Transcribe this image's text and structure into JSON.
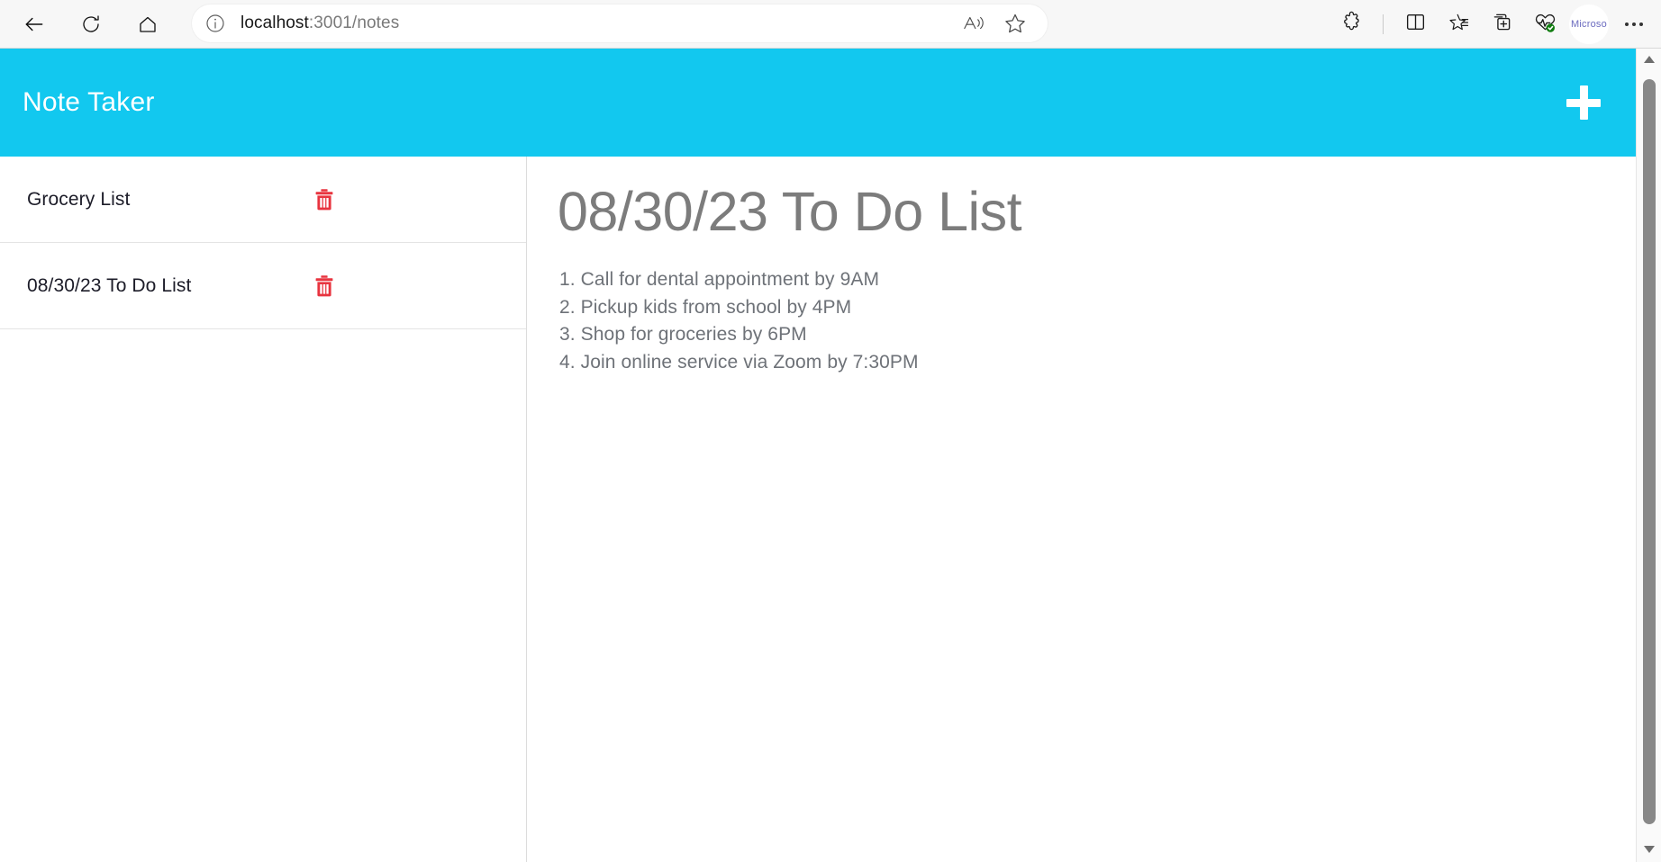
{
  "browser": {
    "nav": [
      {
        "name": "back-button",
        "icon": "back-arrow-icon",
        "label": "Back"
      },
      {
        "name": "refresh-button",
        "icon": "refresh-icon",
        "label": "Refresh"
      },
      {
        "name": "home-button",
        "icon": "home-icon",
        "label": "Home"
      }
    ],
    "address_bar": {
      "info_icon": "site-info-icon",
      "url_host": "localhost",
      "url_rest": ":3001/notes",
      "full_url": "localhost:3001/notes",
      "placeholder": "Search or enter web address",
      "read_aloud_icon": "read-aloud-icon",
      "favorite_icon": "favorite-star-icon"
    },
    "toolbar_right": [
      {
        "name": "extensions-button",
        "icon": "extensions-puzzle-icon",
        "label": "Extensions"
      },
      {
        "name": "split-screen-button",
        "icon": "split-screen-icon",
        "label": "Split screen"
      },
      {
        "name": "favorites-button",
        "icon": "favorites-list-icon",
        "label": "Favorites"
      },
      {
        "name": "collections-button",
        "icon": "collections-icon",
        "label": "Collections"
      },
      {
        "name": "browser-essentials-button",
        "icon": "browser-essentials-heart-icon",
        "label": "Browser essentials"
      }
    ],
    "profile": {
      "name": "profile-chip",
      "label": "Microso"
    },
    "settings_menu": {
      "name": "settings-and-more-button",
      "label": "Settings and more"
    }
  },
  "app": {
    "header": {
      "title": "Note Taker",
      "add_button_label": "+",
      "background_color": "#12c8ef",
      "title_color": "#ffffff"
    },
    "sidebar": {
      "notes": [
        {
          "title": "Grocery List",
          "delete_icon": "trash-icon"
        },
        {
          "title": "08/30/23 To Do List",
          "delete_icon": "trash-icon"
        }
      ],
      "delete_icon_color": "#e8343f"
    },
    "note_view": {
      "title": "08/30/23 To Do List",
      "lines": [
        "1. Call for dental appointment by 9AM",
        "2. Pickup kids from school by 4PM",
        "3. Shop for groceries by 6PM",
        "4. Join online service via Zoom by 7:30PM"
      ],
      "text_color": "#6e7278"
    }
  },
  "scrollbar": {
    "up_arrow": "scroll-up-arrow-icon",
    "down_arrow": "scroll-down-arrow-icon"
  }
}
